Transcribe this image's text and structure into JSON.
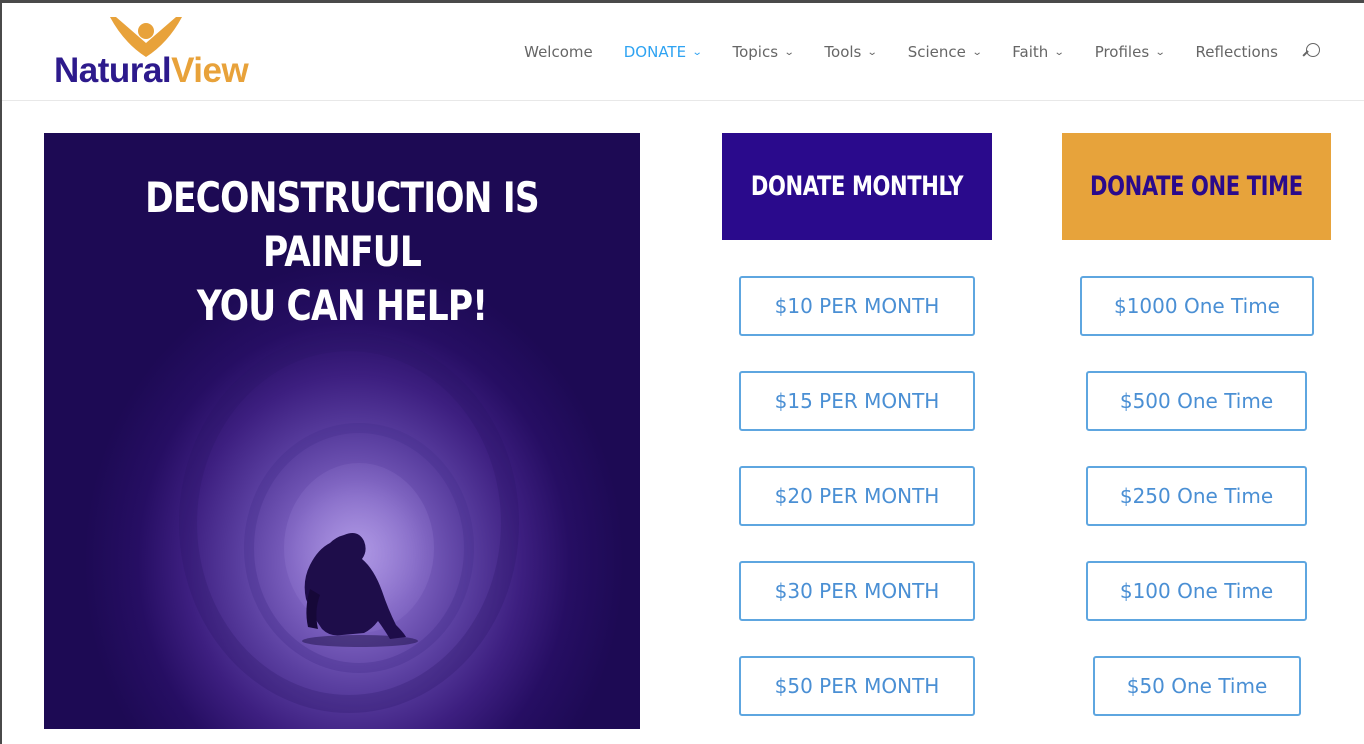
{
  "brand": {
    "part1": "Natural",
    "part2": "View"
  },
  "nav": {
    "items": [
      {
        "label": "Welcome",
        "chevron": false,
        "active": false
      },
      {
        "label": "DONATE",
        "chevron": true,
        "active": true
      },
      {
        "label": "Topics",
        "chevron": true,
        "active": false
      },
      {
        "label": "Tools",
        "chevron": true,
        "active": false
      },
      {
        "label": "Science",
        "chevron": true,
        "active": false
      },
      {
        "label": "Faith",
        "chevron": true,
        "active": false
      },
      {
        "label": "Profiles",
        "chevron": true,
        "active": false
      },
      {
        "label": "Reflections",
        "chevron": false,
        "active": false
      }
    ],
    "chevron_glyph": "⌄",
    "search_icon": "search-icon"
  },
  "hero": {
    "line1": "DECONSTRUCTION IS PAINFUL",
    "line2": "YOU CAN HELP!"
  },
  "donate": {
    "monthly_title": "DONATE MONTHLY",
    "onetime_title": "DONATE ONE TIME",
    "monthly": [
      "$10 PER MONTH",
      "$15 PER MONTH",
      "$20 PER MONTH",
      "$30 PER MONTH",
      "$50 PER MONTH"
    ],
    "onetime": [
      "$1000 One Time",
      "$500 One Time",
      "$250 One Time",
      "$100 One Time",
      "$50 One Time"
    ]
  },
  "colors": {
    "brand_purple": "#2a0a8c",
    "brand_orange": "#e7a33b",
    "link_blue": "#2ea3f2",
    "button_blue": "#4a8fd4"
  }
}
